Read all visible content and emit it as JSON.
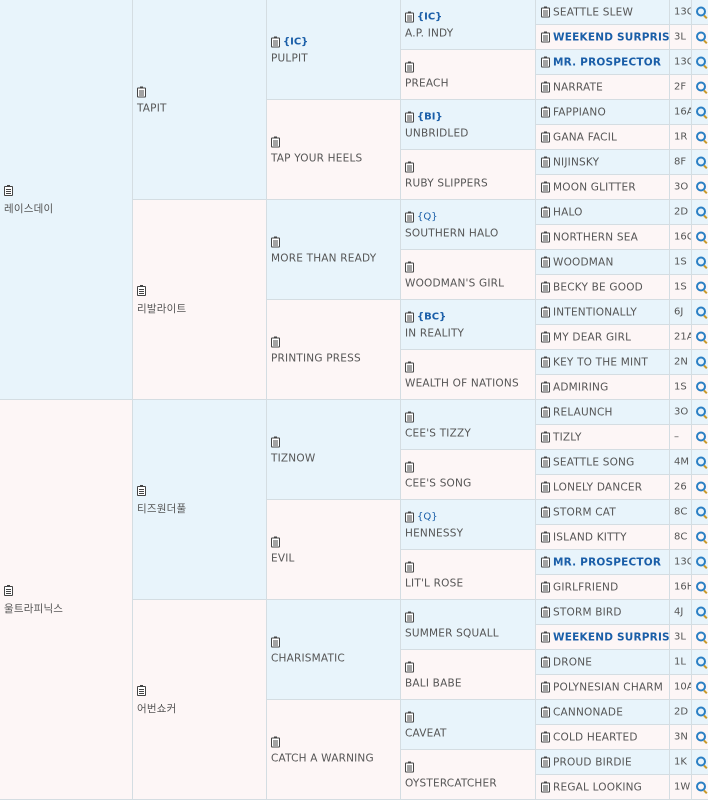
{
  "gen1": [
    {
      "name": "레이스데이",
      "tag": "",
      "bg": "blue"
    },
    {
      "name": "울트라피닉스",
      "tag": "",
      "bg": "pink"
    }
  ],
  "gen2": [
    {
      "name": "TAPIT",
      "tag": "",
      "bg": "blue"
    },
    {
      "name": "리발라이트",
      "tag": "",
      "bg": "pink"
    },
    {
      "name": "티즈원더풀",
      "tag": "",
      "bg": "blue"
    },
    {
      "name": "어번쇼커",
      "tag": "",
      "bg": "pink"
    }
  ],
  "gen3": [
    {
      "name": "PULPIT",
      "tag": "{IC}",
      "bg": "blue"
    },
    {
      "name": "TAP YOUR HEELS",
      "tag": "",
      "bg": "pink"
    },
    {
      "name": "MORE THAN READY",
      "tag": "",
      "bg": "blue"
    },
    {
      "name": "PRINTING PRESS",
      "tag": "",
      "bg": "pink"
    },
    {
      "name": "TIZNOW",
      "tag": "",
      "bg": "blue"
    },
    {
      "name": "EVIL",
      "tag": "",
      "bg": "pink"
    },
    {
      "name": "CHARISMATIC",
      "tag": "",
      "bg": "blue"
    },
    {
      "name": "CATCH A WARNING",
      "tag": "",
      "bg": "pink"
    }
  ],
  "gen4": [
    {
      "name": "A.P. INDY",
      "tag": "{IC}",
      "bold": true,
      "bg": "blue"
    },
    {
      "name": "PREACH",
      "tag": "",
      "bold": false,
      "bg": "pink"
    },
    {
      "name": "UNBRIDLED",
      "tag": "{BI}",
      "bold": true,
      "bg": "blue"
    },
    {
      "name": "RUBY SLIPPERS",
      "tag": "",
      "bold": false,
      "bg": "pink"
    },
    {
      "name": "SOUTHERN HALO",
      "tag": "{Q}",
      "bold": false,
      "bg": "blue"
    },
    {
      "name": "WOODMAN'S GIRL",
      "tag": "",
      "bold": false,
      "bg": "pink"
    },
    {
      "name": "IN REALITY",
      "tag": "{BC}",
      "bold": true,
      "bg": "blue"
    },
    {
      "name": "WEALTH OF NATIONS",
      "tag": "",
      "bold": false,
      "bg": "pink"
    },
    {
      "name": "CEE'S TIZZY",
      "tag": "",
      "bold": false,
      "bg": "blue"
    },
    {
      "name": "CEE'S SONG",
      "tag": "",
      "bold": false,
      "bg": "pink"
    },
    {
      "name": "HENNESSY",
      "tag": "{Q}",
      "bold": false,
      "bg": "blue"
    },
    {
      "name": "LIT'L ROSE",
      "tag": "",
      "bold": false,
      "bg": "pink"
    },
    {
      "name": "SUMMER SQUALL",
      "tag": "",
      "bold": false,
      "bg": "blue"
    },
    {
      "name": "BALI BABE",
      "tag": "",
      "bold": false,
      "bg": "pink"
    },
    {
      "name": "CAVEAT",
      "tag": "",
      "bold": false,
      "bg": "blue"
    },
    {
      "name": "OYSTERCATCHER",
      "tag": "",
      "bold": false,
      "bg": "pink"
    }
  ],
  "gen5": [
    {
      "name": "SEATTLE SLEW",
      "code": "13C",
      "highlight": false,
      "bg": "blue"
    },
    {
      "name": "WEEKEND SURPRISE",
      "code": "3L",
      "highlight": true,
      "bg": "pink"
    },
    {
      "name": "MR. PROSPECTOR",
      "code": "13C",
      "highlight": true,
      "bg": "blue"
    },
    {
      "name": "NARRATE",
      "code": "2F",
      "highlight": false,
      "bg": "pink"
    },
    {
      "name": "FAPPIANO",
      "code": "16A",
      "highlight": false,
      "bg": "blue"
    },
    {
      "name": "GANA FACIL",
      "code": "1R",
      "highlight": false,
      "bg": "pink"
    },
    {
      "name": "NIJINSKY",
      "code": "8F",
      "highlight": false,
      "bg": "blue"
    },
    {
      "name": "MOON GLITTER",
      "code": "3O",
      "highlight": false,
      "bg": "pink"
    },
    {
      "name": "HALO",
      "code": "2D",
      "highlight": false,
      "bg": "blue"
    },
    {
      "name": "NORTHERN SEA",
      "code": "16C",
      "highlight": false,
      "bg": "pink"
    },
    {
      "name": "WOODMAN",
      "code": "1S",
      "highlight": false,
      "bg": "blue"
    },
    {
      "name": "BECKY BE GOOD",
      "code": "1S",
      "highlight": false,
      "bg": "pink"
    },
    {
      "name": "INTENTIONALLY",
      "code": "6J",
      "highlight": false,
      "bg": "blue"
    },
    {
      "name": "MY DEAR GIRL",
      "code": "21A",
      "highlight": false,
      "bg": "pink"
    },
    {
      "name": "KEY TO THE MINT",
      "code": "2N",
      "highlight": false,
      "bg": "blue"
    },
    {
      "name": "ADMIRING",
      "code": "1S",
      "highlight": false,
      "bg": "pink"
    },
    {
      "name": "RELAUNCH",
      "code": "3O",
      "highlight": false,
      "bg": "blue"
    },
    {
      "name": "TIZLY",
      "code": "–",
      "highlight": false,
      "bg": "pink"
    },
    {
      "name": "SEATTLE SONG",
      "code": "4M",
      "highlight": false,
      "bg": "blue"
    },
    {
      "name": "LONELY DANCER",
      "code": "26",
      "highlight": false,
      "bg": "pink"
    },
    {
      "name": "STORM CAT",
      "code": "8C",
      "highlight": false,
      "bg": "blue"
    },
    {
      "name": "ISLAND KITTY",
      "code": "8C",
      "highlight": false,
      "bg": "pink"
    },
    {
      "name": "MR. PROSPECTOR",
      "code": "13C",
      "highlight": true,
      "bg": "blue"
    },
    {
      "name": "GIRLFRIEND",
      "code": "16H",
      "highlight": false,
      "bg": "pink"
    },
    {
      "name": "STORM BIRD",
      "code": "4J",
      "highlight": false,
      "bg": "blue"
    },
    {
      "name": "WEEKEND SURPRISE",
      "code": "3L",
      "highlight": true,
      "bg": "pink"
    },
    {
      "name": "DRONE",
      "code": "1L",
      "highlight": false,
      "bg": "blue"
    },
    {
      "name": "POLYNESIAN CHARM",
      "code": "10A",
      "highlight": false,
      "bg": "pink"
    },
    {
      "name": "CANNONADE",
      "code": "2D",
      "highlight": false,
      "bg": "blue"
    },
    {
      "name": "COLD HEARTED",
      "code": "3N",
      "highlight": false,
      "bg": "pink"
    },
    {
      "name": "PROUD BIRDIE",
      "code": "1K",
      "highlight": false,
      "bg": "blue"
    },
    {
      "name": "REGAL LOOKING",
      "code": "1W",
      "highlight": false,
      "bg": "pink"
    }
  ],
  "icons": {
    "memo": "memo-icon",
    "search": "search-icon"
  },
  "colors": {
    "blue_cell": "#e8f4fb",
    "pink_cell": "#fdf6f6",
    "link": "#1a5ea8",
    "border": "#d4dde2"
  }
}
